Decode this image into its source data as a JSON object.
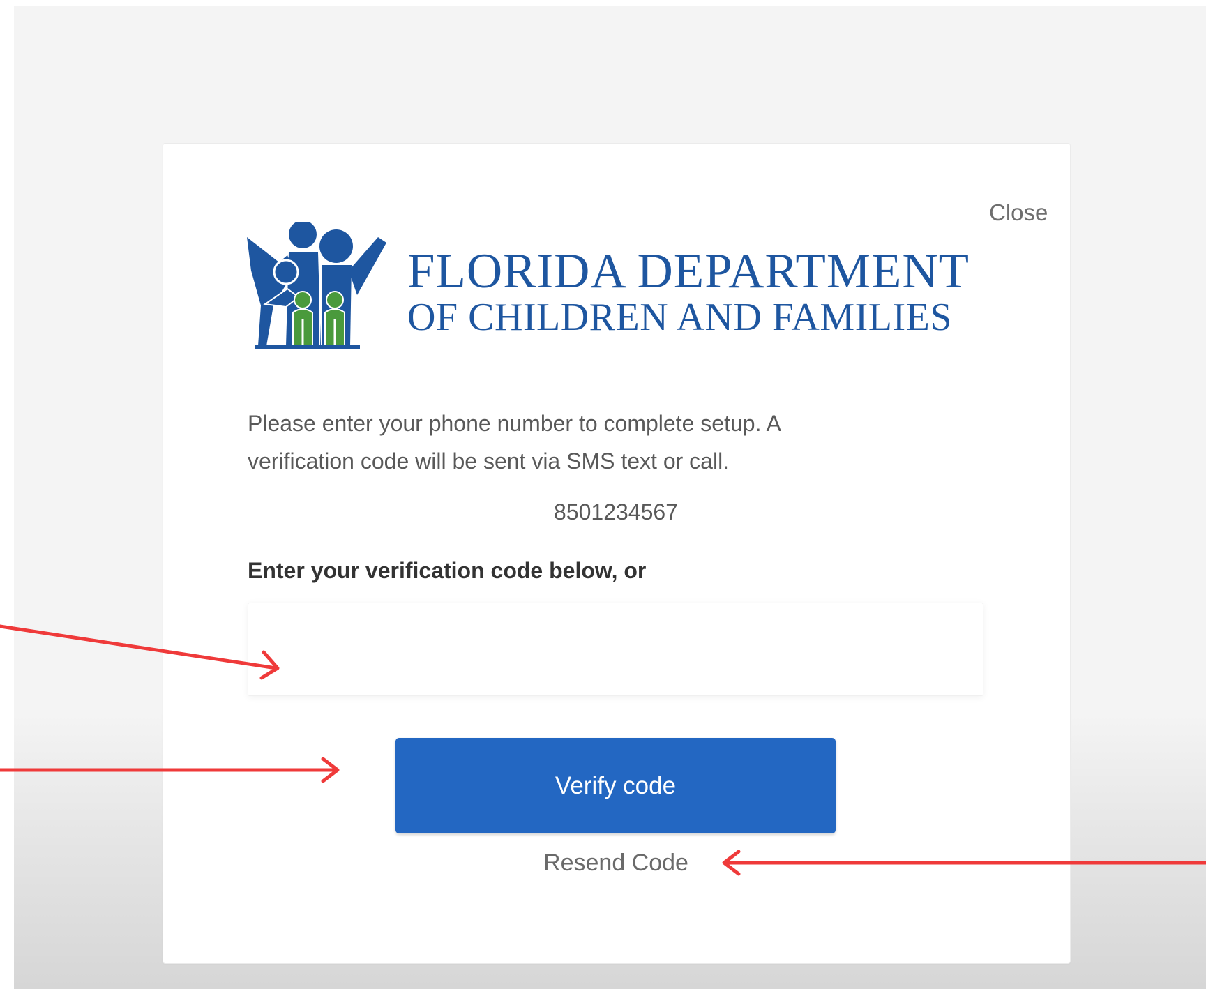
{
  "dialog": {
    "close_label": "Close",
    "logo": {
      "line1": "FLORIDA DEPARTMENT",
      "line2": "OF CHILDREN AND FAMILIES"
    },
    "instructions": "Please enter your phone number to complete setup. A verification code will be sent via SMS text or call.",
    "phone_number": "8501234567",
    "code_label": "Enter your verification code below, or",
    "code_input": {
      "value": "",
      "placeholder": ""
    },
    "verify_button_label": "Verify code",
    "resend_label": "Resend Code"
  },
  "colors": {
    "brand_blue": "#1e56a0",
    "button_blue": "#2367c2",
    "logo_green": "#4a9a3c",
    "annotation_red": "#ef3a3a"
  }
}
